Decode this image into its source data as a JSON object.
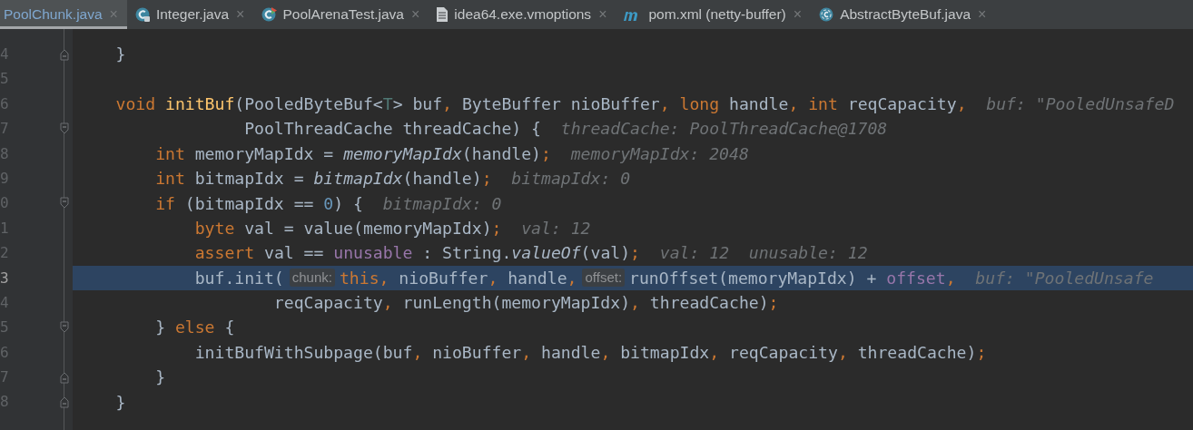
{
  "tabs": [
    {
      "label": "PoolChunk.java",
      "selected": true
    },
    {
      "label": "Integer.java",
      "kind": "locked",
      "selected": false
    },
    {
      "label": "PoolArenaTest.java",
      "kind": "test",
      "selected": false
    },
    {
      "label": "idea64.exe.vmoptions",
      "kind": "file",
      "selected": false
    },
    {
      "label": "pom.xml (netty-buffer)",
      "kind": "maven",
      "selected": false
    },
    {
      "label": "AbstractByteBuf.java",
      "kind": "abstract",
      "selected": false
    }
  ],
  "close_glyph": "×",
  "lines": [
    {
      "number": "4",
      "kind": "fold-end",
      "current": false,
      "tokens": [
        {
          "kind": "plain",
          "text": "    }"
        }
      ]
    },
    {
      "number": "5",
      "kind": "plain",
      "current": false
    },
    {
      "number": "6",
      "kind": "plain",
      "current": false,
      "tokens": [
        {
          "kind": "kw",
          "text": "    void "
        },
        {
          "kind": "decl",
          "text": "initBuf"
        },
        {
          "kind": "plain",
          "text": "(PooledByteBuf<"
        },
        {
          "kind": "generic",
          "text": "T"
        },
        {
          "kind": "plain",
          "text": "> buf"
        },
        {
          "kind": "punct",
          "text": ","
        },
        {
          "kind": "plain",
          "text": " ByteBuffer nioBuffer"
        },
        {
          "kind": "punct",
          "text": ","
        },
        {
          "kind": "kw",
          "text": " long"
        },
        {
          "kind": "plain",
          "text": " handle"
        },
        {
          "kind": "punct",
          "text": ","
        },
        {
          "kind": "kw",
          "text": " int"
        },
        {
          "kind": "plain",
          "text": " reqCapacity"
        },
        {
          "kind": "punct",
          "text": ","
        },
        {
          "kind": "hint",
          "text": "buf: \"PooledUnsafeD"
        }
      ]
    },
    {
      "number": "7",
      "kind": "fold-start",
      "current": false,
      "tokens": [
        {
          "kind": "plain",
          "text": "                 PoolThreadCache threadCache) {"
        },
        {
          "kind": "hint",
          "text": "threadCache: PoolThreadCache@1708"
        }
      ]
    },
    {
      "number": "8",
      "kind": "plain",
      "current": false,
      "tokens": [
        {
          "kind": "kw",
          "text": "        int"
        },
        {
          "kind": "plain",
          "text": " memoryMapIdx = "
        },
        {
          "kind": "static",
          "text": "memoryMapIdx"
        },
        {
          "kind": "plain",
          "text": "(handle)"
        },
        {
          "kind": "punct",
          "text": ";"
        },
        {
          "kind": "hint",
          "text": "memoryMapIdx: 2048"
        }
      ]
    },
    {
      "number": "9",
      "kind": "plain",
      "current": false,
      "tokens": [
        {
          "kind": "kw",
          "text": "        int"
        },
        {
          "kind": "plain",
          "text": " bitmapIdx = "
        },
        {
          "kind": "static",
          "text": "bitmapIdx"
        },
        {
          "kind": "plain",
          "text": "(handle)"
        },
        {
          "kind": "punct",
          "text": ";"
        },
        {
          "kind": "hint",
          "text": "bitmapIdx: 0"
        }
      ]
    },
    {
      "number": "0",
      "kind": "fold-start",
      "current": false,
      "tokens": [
        {
          "kind": "kw",
          "text": "        if"
        },
        {
          "kind": "plain",
          "text": " (bitmapIdx == "
        },
        {
          "kind": "num",
          "text": "0"
        },
        {
          "kind": "plain",
          "text": ") {"
        },
        {
          "kind": "hint",
          "text": "bitmapIdx: 0"
        }
      ]
    },
    {
      "number": "1",
      "kind": "plain",
      "current": false,
      "tokens": [
        {
          "kind": "kw",
          "text": "            byte"
        },
        {
          "kind": "plain",
          "text": " val = value(memoryMapIdx)"
        },
        {
          "kind": "punct",
          "text": ";"
        },
        {
          "kind": "hint",
          "text": "val: 12"
        }
      ]
    },
    {
      "number": "2",
      "kind": "plain",
      "current": false,
      "tokens": [
        {
          "kind": "kw",
          "text": "            assert"
        },
        {
          "kind": "plain",
          "text": " val == "
        },
        {
          "kind": "field",
          "text": "unusable"
        },
        {
          "kind": "plain",
          "text": " : String."
        },
        {
          "kind": "static",
          "text": "valueOf"
        },
        {
          "kind": "plain",
          "text": "(val)"
        },
        {
          "kind": "punct",
          "text": ";"
        },
        {
          "kind": "hint",
          "text": "val: 12"
        },
        {
          "kind": "hint",
          "text": "unusable: 12"
        }
      ]
    },
    {
      "number": "3",
      "kind": "plain",
      "current": true,
      "tokens": [
        {
          "kind": "plain",
          "text": "            buf.init("
        },
        {
          "kind": "param",
          "text": "chunk:"
        },
        {
          "kind": "kw",
          "text": "this"
        },
        {
          "kind": "punct",
          "text": ","
        },
        {
          "kind": "plain",
          "text": " nioBuffer"
        },
        {
          "kind": "punct",
          "text": ","
        },
        {
          "kind": "plain",
          "text": " handle"
        },
        {
          "kind": "punct",
          "text": ","
        },
        {
          "kind": "param",
          "text": "offset:"
        },
        {
          "kind": "plain",
          "text": "runOffset(memoryMapIdx) + "
        },
        {
          "kind": "field",
          "text": "offset"
        },
        {
          "kind": "punct",
          "text": ","
        },
        {
          "kind": "hint",
          "text": "buf: \"PooledUnsafe"
        }
      ]
    },
    {
      "number": "4",
      "kind": "plain",
      "current": false,
      "tokens": [
        {
          "kind": "plain",
          "text": "                    reqCapacity"
        },
        {
          "kind": "punct",
          "text": ","
        },
        {
          "kind": "plain",
          "text": " runLength(memoryMapIdx)"
        },
        {
          "kind": "punct",
          "text": ","
        },
        {
          "kind": "plain",
          "text": " threadCache)"
        },
        {
          "kind": "punct",
          "text": ";"
        }
      ]
    },
    {
      "number": "5",
      "kind": "fold-start",
      "current": false,
      "tokens": [
        {
          "kind": "plain",
          "text": "        } "
        },
        {
          "kind": "kw",
          "text": "else"
        },
        {
          "kind": "plain",
          "text": " {"
        }
      ]
    },
    {
      "number": "6",
      "kind": "plain",
      "current": false,
      "tokens": [
        {
          "kind": "plain",
          "text": "            initBufWithSubpage(buf"
        },
        {
          "kind": "punct",
          "text": ","
        },
        {
          "kind": "plain",
          "text": " nioBuffer"
        },
        {
          "kind": "punct",
          "text": ","
        },
        {
          "kind": "plain",
          "text": " handle"
        },
        {
          "kind": "punct",
          "text": ","
        },
        {
          "kind": "plain",
          "text": " bitmapIdx"
        },
        {
          "kind": "punct",
          "text": ","
        },
        {
          "kind": "plain",
          "text": " reqCapacity"
        },
        {
          "kind": "punct",
          "text": ","
        },
        {
          "kind": "plain",
          "text": " threadCache)"
        },
        {
          "kind": "punct",
          "text": ";"
        }
      ]
    },
    {
      "number": "7",
      "kind": "fold-end",
      "current": false,
      "tokens": [
        {
          "kind": "plain",
          "text": "        }"
        }
      ]
    },
    {
      "number": "8",
      "kind": "fold-end",
      "current": false,
      "tokens": [
        {
          "kind": "plain",
          "text": "    }"
        }
      ]
    }
  ]
}
